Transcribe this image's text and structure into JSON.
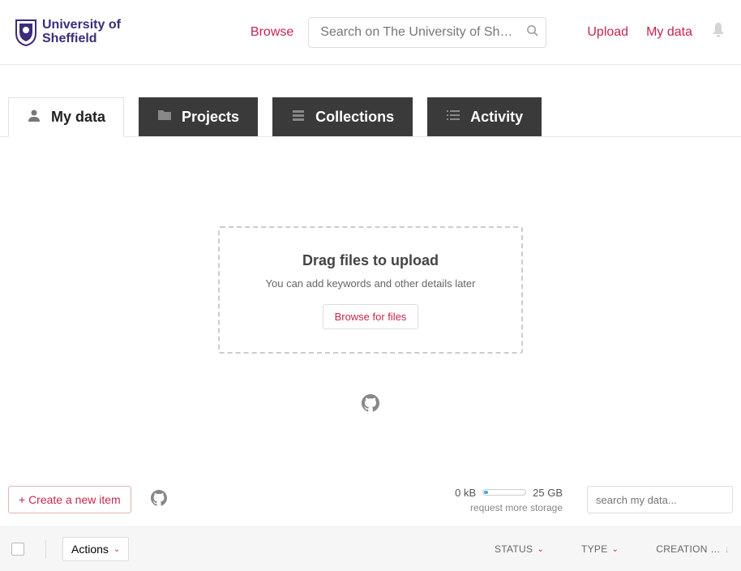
{
  "header": {
    "institution_line1": "University of",
    "institution_line2": "Sheffield",
    "browse": "Browse",
    "search_placeholder": "Search on The University of Sh…",
    "upload": "Upload",
    "mydata": "My data"
  },
  "tabs": [
    {
      "id": "mydata",
      "label": "My data",
      "active": true
    },
    {
      "id": "projects",
      "label": "Projects",
      "active": false
    },
    {
      "id": "collections",
      "label": "Collections",
      "active": false
    },
    {
      "id": "activity",
      "label": "Activity",
      "active": false
    }
  ],
  "dropzone": {
    "title": "Drag files to upload",
    "subtitle": "You can add keywords and other details later",
    "browse": "Browse for files"
  },
  "toolbar": {
    "create": "+ Create a new item",
    "storage_used": "0 kB",
    "storage_total": "25 GB",
    "request_more": "request more storage",
    "filter_placeholder": "search my data..."
  },
  "table": {
    "actions": "Actions",
    "columns": {
      "status": "STATUS",
      "type": "TYPE",
      "creation": "CREATION …"
    }
  },
  "colors": {
    "brand_red": "#c7254e",
    "brand_purple": "#3b2d7a"
  }
}
